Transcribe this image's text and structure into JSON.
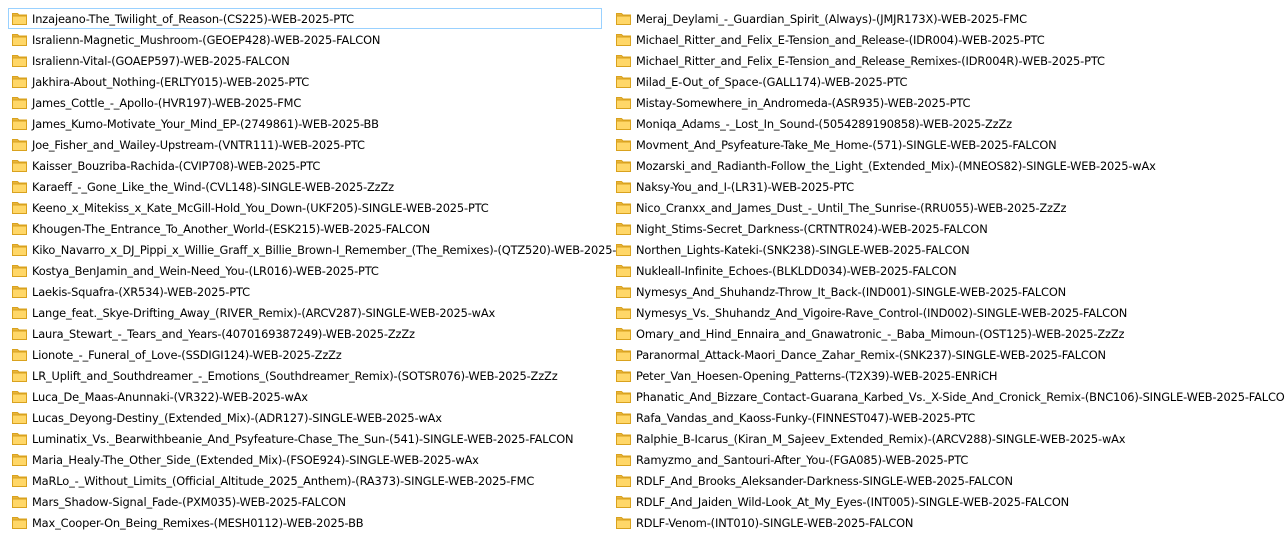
{
  "colors": {
    "folder_fill": "#ffd768",
    "folder_tab": "#e8b43c",
    "folder_edge": "#d9a21e",
    "selection_border": "#99d1ff"
  },
  "icon": "folder-icon",
  "selected_item": "Inzajeano-The_Twilight_of_Reason-(CS225)-WEB-2025-PTC",
  "left_column": [
    "Inzajeano-The_Twilight_of_Reason-(CS225)-WEB-2025-PTC",
    "Isralienn-Magnetic_Mushroom-(GEOEP428)-WEB-2025-FALCON",
    "Isralienn-Vital-(GOAEP597)-WEB-2025-FALCON",
    "Jakhira-About_Nothing-(ERLTY015)-WEB-2025-PTC",
    "James_Cottle_-_Apollo-(HVR197)-WEB-2025-FMC",
    "James_Kumo-Motivate_Your_Mind_EP-(2749861)-WEB-2025-BB",
    "Joe_Fisher_and_Wailey-Upstream-(VNTR111)-WEB-2025-PTC",
    "Kaisser_Bouzriba-Rachida-(CVIP708)-WEB-2025-PTC",
    "Karaeff_-_Gone_Like_the_Wind-(CVL148)-SINGLE-WEB-2025-ZzZz",
    "Keeno_x_Mitekiss_x_Kate_McGill-Hold_You_Down-(UKF205)-SINGLE-WEB-2025-PTC",
    "Khougen-The_Entrance_To_Another_World-(ESK215)-WEB-2025-FALCON",
    "Kiko_Navarro_x_DJ_Pippi_x_Willie_Graff_x_Billie_Brown-I_Remember_(The_Remixes)-(QTZ520)-WEB-2025-BB",
    "Kostya_BenJamin_and_Wein-Need_You-(LR016)-WEB-2025-PTC",
    "Laekis-Squafra-(XR534)-WEB-2025-PTC",
    "Lange_feat._Skye-Drifting_Away_(RIVER_Remix)-(ARCV287)-SINGLE-WEB-2025-wAx",
    "Laura_Stewart_-_Tears_and_Years-(4070169387249)-WEB-2025-ZzZz",
    "Lionote_-_Funeral_of_Love-(SSDIGI124)-WEB-2025-ZzZz",
    "LR_Uplift_and_Southdreamer_-_Emotions_(Southdreamer_Remix)-(SOTSR076)-WEB-2025-ZzZz",
    "Luca_De_Maas-Anunnaki-(VR322)-WEB-2025-wAx",
    "Lucas_Deyong-Destiny_(Extended_Mix)-(ADR127)-SINGLE-WEB-2025-wAx",
    "Luminatix_Vs._Bearwithbeanie_And_Psyfeature-Chase_The_Sun-(541)-SINGLE-WEB-2025-FALCON",
    "Maria_Healy-The_Other_Side_(Extended_Mix)-(FSOE924)-SINGLE-WEB-2025-wAx",
    "MaRLo_-_Without_Limits_(Official_Altitude_2025_Anthem)-(RA373)-SINGLE-WEB-2025-FMC",
    "Mars_Shadow-Signal_Fade-(PXM035)-WEB-2025-FALCON",
    "Max_Cooper-On_Being_Remixes-(MESH0112)-WEB-2025-BB"
  ],
  "right_column": [
    "Meraj_Deylami_-_Guardian_Spirit_(Always)-(JMJR173X)-WEB-2025-FMC",
    "Michael_Ritter_and_Felix_E-Tension_and_Release-(IDR004)-WEB-2025-PTC",
    "Michael_Ritter_and_Felix_E-Tension_and_Release_Remixes-(IDR004R)-WEB-2025-PTC",
    "Milad_E-Out_of_Space-(GALL174)-WEB-2025-PTC",
    "Mistay-Somewhere_in_Andromeda-(ASR935)-WEB-2025-PTC",
    "Moniqa_Adams_-_Lost_In_Sound-(5054289190858)-WEB-2025-ZzZz",
    "Movment_And_Psyfeature-Take_Me_Home-(571)-SINGLE-WEB-2025-FALCON",
    "Mozarski_and_Radianth-Follow_the_Light_(Extended_Mix)-(MNEOS82)-SINGLE-WEB-2025-wAx",
    "Naksy-You_and_I-(LR31)-WEB-2025-PTC",
    "Nico_Cranxx_and_James_Dust_-_Until_The_Sunrise-(RRU055)-WEB-2025-ZzZz",
    "Night_Stims-Secret_Darkness-(CRTNTR024)-WEB-2025-FALCON",
    "Northen_Lights-Kateki-(SNK238)-SINGLE-WEB-2025-FALCON",
    "Nukleall-Infinite_Echoes-(BLKLDD034)-WEB-2025-FALCON",
    "Nymesys_And_Shuhandz-Throw_It_Back-(IND001)-SINGLE-WEB-2025-FALCON",
    "Nymesys_Vs._Shuhandz_And_Vigoire-Rave_Control-(IND002)-SINGLE-WEB-2025-FALCON",
    "Omary_and_Hind_Ennaira_and_Gnawatronic_-_Baba_Mimoun-(OST125)-WEB-2025-ZzZz",
    "Paranormal_Attack-Maori_Dance_Zahar_Remix-(SNK237)-SINGLE-WEB-2025-FALCON",
    "Peter_Van_Hoesen-Opening_Patterns-(T2X39)-WEB-2025-ENRiCH",
    "Phanatic_And_Bizzare_Contact-Guarana_Karbed_Vs._X-Side_And_Cronick_Remix-(BNC106)-SINGLE-WEB-2025-FALCON",
    "Rafa_Vandas_and_Kaoss-Funky-(FINNEST047)-WEB-2025-PTC",
    "Ralphie_B-Icarus_(Kiran_M_Sajeev_Extended_Remix)-(ARCV288)-SINGLE-WEB-2025-wAx",
    "Ramyzmo_and_Santouri-After_You-(FGA085)-WEB-2025-PTC",
    "RDLF_And_Brooks_Aleksander-Darkness-SINGLE-WEB-2025-FALCON",
    "RDLF_And_Jaiden_Wild-Look_At_My_Eyes-(INT005)-SINGLE-WEB-2025-FALCON",
    "RDLF-Venom-(INT010)-SINGLE-WEB-2025-FALCON"
  ]
}
